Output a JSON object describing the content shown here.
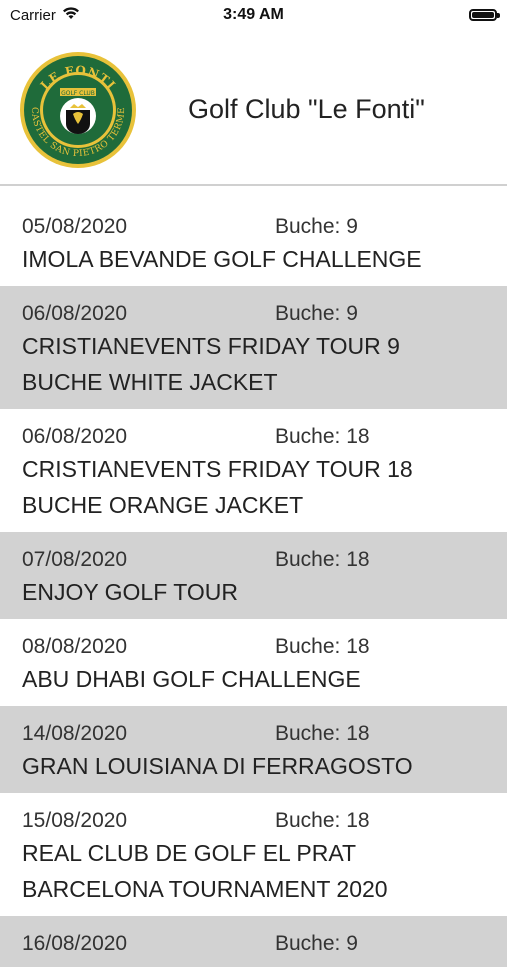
{
  "status_bar": {
    "carrier": "Carrier",
    "time": "3:49 AM"
  },
  "header": {
    "title": "Golf Club \"Le Fonti\"",
    "logo": {
      "top_text": "LE FONTI",
      "sub_text": "GOLF CLUB",
      "ring_text": "CASTEL SAN PIETRO TERME",
      "colors": {
        "green": "#1f6b3a",
        "gold": "#e8c23a",
        "black": "#111111"
      }
    }
  },
  "events": [
    {
      "date": "05/08/2020",
      "holes": "Buche: 9",
      "title": "IMOLA BEVANDE GOLF CHALLENGE",
      "shaded": false
    },
    {
      "date": "06/08/2020",
      "holes": "Buche: 9",
      "title": "CRISTIANEVENTS FRIDAY TOUR 9 BUCHE WHITE JACKET",
      "shaded": true
    },
    {
      "date": "06/08/2020",
      "holes": "Buche: 18",
      "title": "CRISTIANEVENTS FRIDAY TOUR 18 BUCHE ORANGE JACKET",
      "shaded": false
    },
    {
      "date": "07/08/2020",
      "holes": "Buche: 18",
      "title": "ENJOY GOLF TOUR",
      "shaded": true
    },
    {
      "date": "08/08/2020",
      "holes": "Buche: 18",
      "title": "ABU DHABI GOLF CHALLENGE",
      "shaded": false
    },
    {
      "date": "14/08/2020",
      "holes": "Buche: 18",
      "title": "GRAN LOUISIANA DI FERRAGOSTO",
      "shaded": true
    },
    {
      "date": "15/08/2020",
      "holes": "Buche: 18",
      "title": "REAL CLUB DE GOLF EL PRAT BARCELONA TOURNAMENT 2020",
      "shaded": false
    },
    {
      "date": "16/08/2020",
      "holes": "Buche: 9",
      "title": "",
      "shaded": true
    }
  ]
}
